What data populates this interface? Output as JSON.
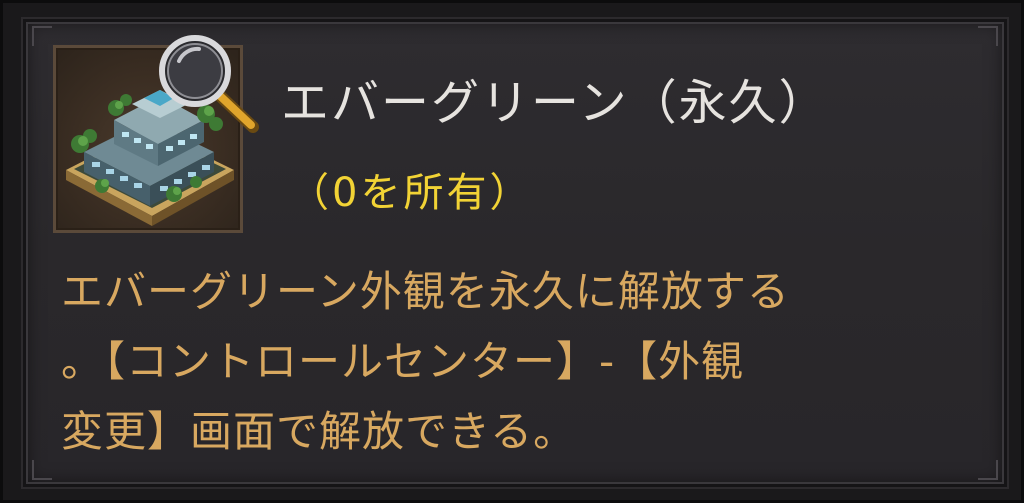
{
  "tooltip": {
    "item_icon": "evergreen-building-icon",
    "inspect_icon": "magnifier-icon",
    "title": "エバーグリーン（永久）",
    "owned": "（0を所有）",
    "description_lines": [
      "エバーグリーン外観を永久に解放する",
      "。【コントロールセンター】-【外観",
      "変更】画面で解放できる。"
    ]
  },
  "colors": {
    "title": "#e6e3df",
    "owned": "#f2d335",
    "description": "#d8a860",
    "panel_bg": "#2c2a2d"
  }
}
